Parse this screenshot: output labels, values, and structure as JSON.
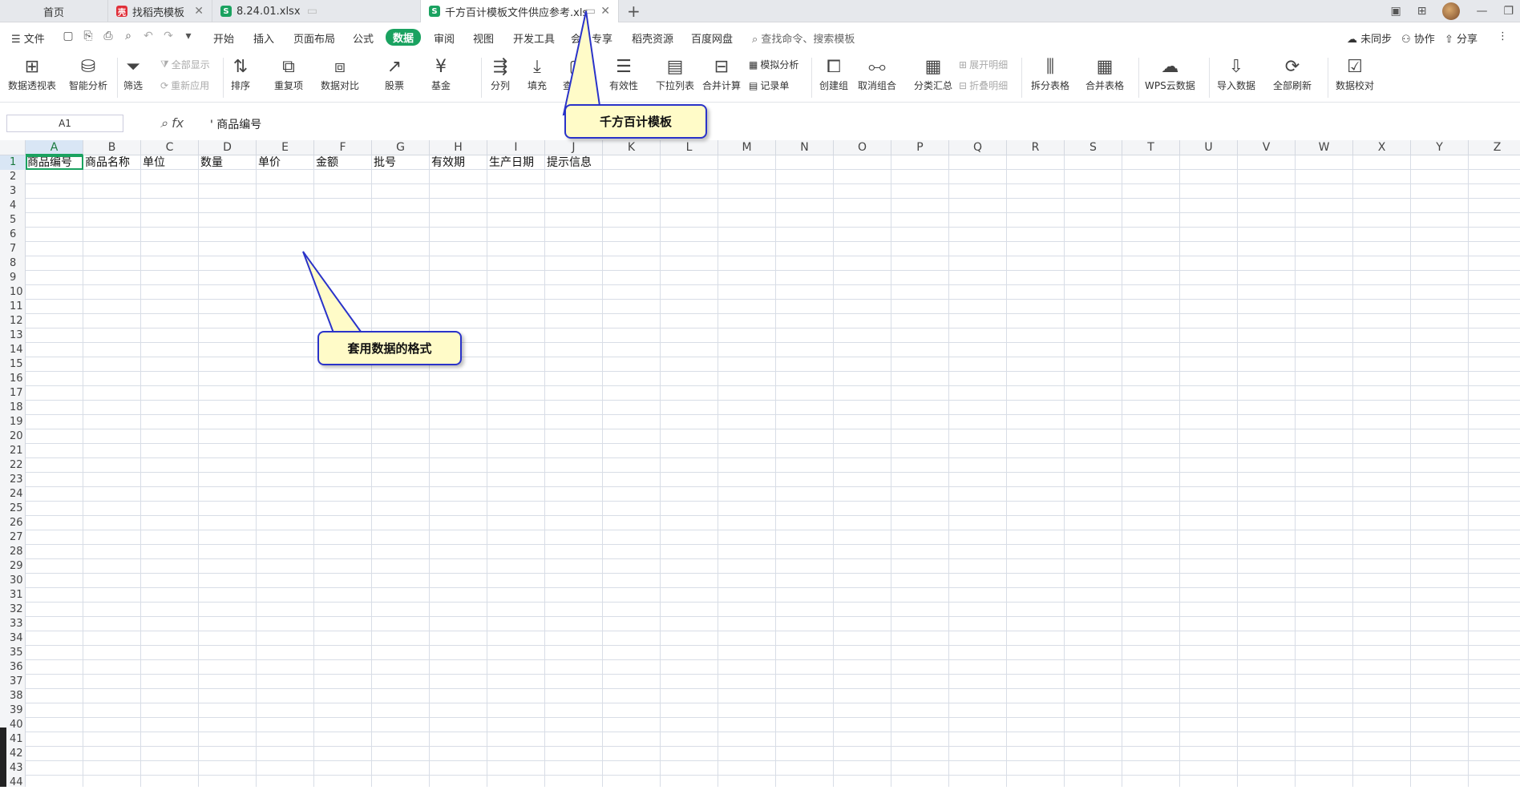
{
  "tabs": [
    {
      "label": "首页",
      "icon": ""
    },
    {
      "label": "找稻壳模板",
      "icon": "docer-icon"
    },
    {
      "label": "8.24.01.xlsx",
      "icon": "sheet-icon"
    },
    {
      "label": "千方百计模板文件供应参考.xls",
      "icon": "sheet-icon"
    }
  ],
  "menu": {
    "file_label": "文件",
    "items": [
      "开始",
      "插入",
      "页面布局",
      "公式",
      "数据",
      "审阅",
      "视图",
      "开发工具",
      "会员专享",
      "稻壳资源",
      "百度网盘"
    ],
    "active": "数据",
    "search_placeholder": "查找命令、搜索模板",
    "right": [
      "未同步",
      "协作",
      "分享"
    ]
  },
  "ribbon": {
    "pivot": "数据透视表",
    "smart": "智能分析",
    "filter": "筛选",
    "show_all": "全部显示",
    "reapply": "重新应用",
    "sort": "排序",
    "duplicate": "重复项",
    "compare": "数据对比",
    "stock": "股票",
    "fund": "基金",
    "split_col": "分列",
    "fill": "填充",
    "lookup": "查找录",
    "validity": "有效性",
    "dropdown": "下拉列表",
    "merge_calc": "合并计算",
    "simulate": "模拟分析",
    "record": "记录单",
    "create_group": "创建组",
    "ungroup": "取消组合",
    "subtotal": "分类汇总",
    "expand": "展开明细",
    "collapse": "折叠明细",
    "split_table": "拆分表格",
    "merge_table": "合并表格",
    "wps_cloud": "WPS云数据",
    "import": "导入数据",
    "refresh_all": "全部刷新",
    "verify": "数据校对"
  },
  "formula_bar": {
    "cell_ref": "A1",
    "fx": "fx",
    "content": "' 商品编号"
  },
  "columns": [
    "A",
    "B",
    "C",
    "D",
    "E",
    "F",
    "G",
    "H",
    "I",
    "J",
    "K",
    "L",
    "M",
    "N",
    "O",
    "P",
    "Q",
    "R",
    "S",
    "T",
    "U",
    "V",
    "W",
    "X",
    "Y",
    "Z"
  ],
  "header_row": [
    "商品编号",
    "商品名称",
    "单位",
    "数量",
    "单价",
    "金额",
    "批号",
    "有效期",
    "生产日期",
    "提示信息"
  ],
  "callouts": {
    "top": "千方百计模板",
    "middle": "套用数据的格式"
  },
  "colors": {
    "accent": "#1aa260",
    "callout_border": "#2a33c9",
    "callout_fill": "#fffbc8"
  }
}
